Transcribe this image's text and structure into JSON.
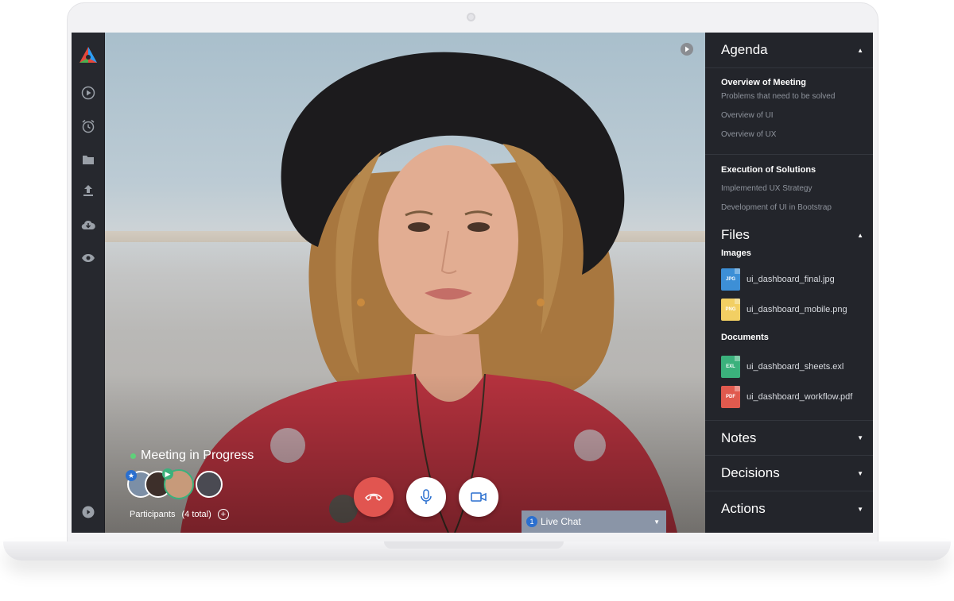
{
  "rail": {
    "icons": [
      "app-logo",
      "play-circle-icon",
      "alarm-clock-icon",
      "folder-icon",
      "upload-icon",
      "cloud-download-icon",
      "eye-icon",
      "collapse-arrow-icon"
    ]
  },
  "video": {
    "status_text": "Meeting in Progress",
    "status_color": "#5fd07a",
    "participants_label": "Participants",
    "participants_count": "(4 total)",
    "add_symbol": "+",
    "controls": {
      "end_call_color": "#e15550",
      "mic_color": "#ffffff",
      "camera_color": "#ffffff"
    }
  },
  "live_chat": {
    "badge": "1",
    "label": "Live Chat"
  },
  "panel": {
    "agenda": {
      "title": "Agenda",
      "groups": [
        {
          "title": "Overview of Meeting",
          "items": [
            "Problems that need to be solved",
            "Overview of UI",
            "Overview of UX"
          ]
        },
        {
          "title": "Execution of Solutions",
          "items": [
            "Implemented UX Strategy",
            "Development of UI in Bootstrap"
          ]
        }
      ]
    },
    "files": {
      "title": "Files",
      "images_label": "Images",
      "images": [
        {
          "type": "JPG",
          "name": "ui_dashboard_final.jpg",
          "color": "#3d8fd6"
        },
        {
          "type": "PNG",
          "name": "ui_dashboard_mobile.png",
          "color": "#f2cf63"
        }
      ],
      "documents_label": "Documents",
      "documents": [
        {
          "type": "EXL",
          "name": "ui_dashboard_sheets.exl",
          "color": "#3bb17c"
        },
        {
          "type": "PDF",
          "name": "ui_dashboard_workflow.pdf",
          "color": "#e05a4e"
        }
      ]
    },
    "notes": {
      "title": "Notes"
    },
    "decisions": {
      "title": "Decisions"
    },
    "actions": {
      "title": "Actions"
    }
  }
}
